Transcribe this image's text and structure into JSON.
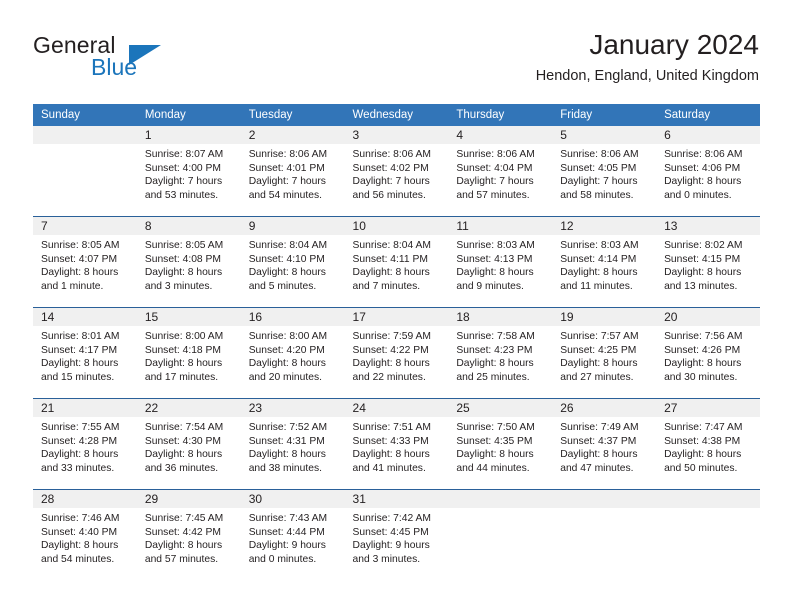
{
  "brand": {
    "name_part1": "General",
    "name_part2": "Blue",
    "accent_color": "#1b75bb"
  },
  "header": {
    "title": "January 2024",
    "location": "Hendon, England, United Kingdom"
  },
  "theme": {
    "header_row_color": "#3275b8",
    "day_band_color": "#f0f0f0",
    "row_divider_color": "#2a6099",
    "text_color": "#231f20"
  },
  "weekday_headers": [
    "Sunday",
    "Monday",
    "Tuesday",
    "Wednesday",
    "Thursday",
    "Friday",
    "Saturday"
  ],
  "weeks": [
    [
      {
        "day": "",
        "lines": []
      },
      {
        "day": "1",
        "lines": [
          "Sunrise: 8:07 AM",
          "Sunset: 4:00 PM",
          "Daylight: 7 hours",
          "and 53 minutes."
        ]
      },
      {
        "day": "2",
        "lines": [
          "Sunrise: 8:06 AM",
          "Sunset: 4:01 PM",
          "Daylight: 7 hours",
          "and 54 minutes."
        ]
      },
      {
        "day": "3",
        "lines": [
          "Sunrise: 8:06 AM",
          "Sunset: 4:02 PM",
          "Daylight: 7 hours",
          "and 56 minutes."
        ]
      },
      {
        "day": "4",
        "lines": [
          "Sunrise: 8:06 AM",
          "Sunset: 4:04 PM",
          "Daylight: 7 hours",
          "and 57 minutes."
        ]
      },
      {
        "day": "5",
        "lines": [
          "Sunrise: 8:06 AM",
          "Sunset: 4:05 PM",
          "Daylight: 7 hours",
          "and 58 minutes."
        ]
      },
      {
        "day": "6",
        "lines": [
          "Sunrise: 8:06 AM",
          "Sunset: 4:06 PM",
          "Daylight: 8 hours",
          "and 0 minutes."
        ]
      }
    ],
    [
      {
        "day": "7",
        "lines": [
          "Sunrise: 8:05 AM",
          "Sunset: 4:07 PM",
          "Daylight: 8 hours",
          "and 1 minute."
        ]
      },
      {
        "day": "8",
        "lines": [
          "Sunrise: 8:05 AM",
          "Sunset: 4:08 PM",
          "Daylight: 8 hours",
          "and 3 minutes."
        ]
      },
      {
        "day": "9",
        "lines": [
          "Sunrise: 8:04 AM",
          "Sunset: 4:10 PM",
          "Daylight: 8 hours",
          "and 5 minutes."
        ]
      },
      {
        "day": "10",
        "lines": [
          "Sunrise: 8:04 AM",
          "Sunset: 4:11 PM",
          "Daylight: 8 hours",
          "and 7 minutes."
        ]
      },
      {
        "day": "11",
        "lines": [
          "Sunrise: 8:03 AM",
          "Sunset: 4:13 PM",
          "Daylight: 8 hours",
          "and 9 minutes."
        ]
      },
      {
        "day": "12",
        "lines": [
          "Sunrise: 8:03 AM",
          "Sunset: 4:14 PM",
          "Daylight: 8 hours",
          "and 11 minutes."
        ]
      },
      {
        "day": "13",
        "lines": [
          "Sunrise: 8:02 AM",
          "Sunset: 4:15 PM",
          "Daylight: 8 hours",
          "and 13 minutes."
        ]
      }
    ],
    [
      {
        "day": "14",
        "lines": [
          "Sunrise: 8:01 AM",
          "Sunset: 4:17 PM",
          "Daylight: 8 hours",
          "and 15 minutes."
        ]
      },
      {
        "day": "15",
        "lines": [
          "Sunrise: 8:00 AM",
          "Sunset: 4:18 PM",
          "Daylight: 8 hours",
          "and 17 minutes."
        ]
      },
      {
        "day": "16",
        "lines": [
          "Sunrise: 8:00 AM",
          "Sunset: 4:20 PM",
          "Daylight: 8 hours",
          "and 20 minutes."
        ]
      },
      {
        "day": "17",
        "lines": [
          "Sunrise: 7:59 AM",
          "Sunset: 4:22 PM",
          "Daylight: 8 hours",
          "and 22 minutes."
        ]
      },
      {
        "day": "18",
        "lines": [
          "Sunrise: 7:58 AM",
          "Sunset: 4:23 PM",
          "Daylight: 8 hours",
          "and 25 minutes."
        ]
      },
      {
        "day": "19",
        "lines": [
          "Sunrise: 7:57 AM",
          "Sunset: 4:25 PM",
          "Daylight: 8 hours",
          "and 27 minutes."
        ]
      },
      {
        "day": "20",
        "lines": [
          "Sunrise: 7:56 AM",
          "Sunset: 4:26 PM",
          "Daylight: 8 hours",
          "and 30 minutes."
        ]
      }
    ],
    [
      {
        "day": "21",
        "lines": [
          "Sunrise: 7:55 AM",
          "Sunset: 4:28 PM",
          "Daylight: 8 hours",
          "and 33 minutes."
        ]
      },
      {
        "day": "22",
        "lines": [
          "Sunrise: 7:54 AM",
          "Sunset: 4:30 PM",
          "Daylight: 8 hours",
          "and 36 minutes."
        ]
      },
      {
        "day": "23",
        "lines": [
          "Sunrise: 7:52 AM",
          "Sunset: 4:31 PM",
          "Daylight: 8 hours",
          "and 38 minutes."
        ]
      },
      {
        "day": "24",
        "lines": [
          "Sunrise: 7:51 AM",
          "Sunset: 4:33 PM",
          "Daylight: 8 hours",
          "and 41 minutes."
        ]
      },
      {
        "day": "25",
        "lines": [
          "Sunrise: 7:50 AM",
          "Sunset: 4:35 PM",
          "Daylight: 8 hours",
          "and 44 minutes."
        ]
      },
      {
        "day": "26",
        "lines": [
          "Sunrise: 7:49 AM",
          "Sunset: 4:37 PM",
          "Daylight: 8 hours",
          "and 47 minutes."
        ]
      },
      {
        "day": "27",
        "lines": [
          "Sunrise: 7:47 AM",
          "Sunset: 4:38 PM",
          "Daylight: 8 hours",
          "and 50 minutes."
        ]
      }
    ],
    [
      {
        "day": "28",
        "lines": [
          "Sunrise: 7:46 AM",
          "Sunset: 4:40 PM",
          "Daylight: 8 hours",
          "and 54 minutes."
        ]
      },
      {
        "day": "29",
        "lines": [
          "Sunrise: 7:45 AM",
          "Sunset: 4:42 PM",
          "Daylight: 8 hours",
          "and 57 minutes."
        ]
      },
      {
        "day": "30",
        "lines": [
          "Sunrise: 7:43 AM",
          "Sunset: 4:44 PM",
          "Daylight: 9 hours",
          "and 0 minutes."
        ]
      },
      {
        "day": "31",
        "lines": [
          "Sunrise: 7:42 AM",
          "Sunset: 4:45 PM",
          "Daylight: 9 hours",
          "and 3 minutes."
        ]
      },
      {
        "day": "",
        "lines": []
      },
      {
        "day": "",
        "lines": []
      },
      {
        "day": "",
        "lines": []
      }
    ]
  ]
}
